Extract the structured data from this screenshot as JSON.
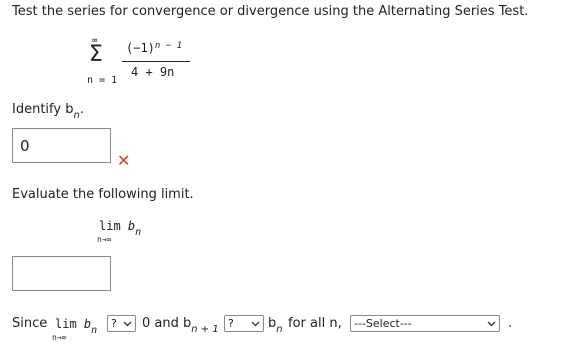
{
  "instructions": "Test the series for convergence or divergence using the Alternating Series Test.",
  "series": {
    "sigma": "Σ",
    "upper": "∞",
    "lower": "n = 1",
    "numerator_base": "(−1)",
    "numerator_exp": "n − 1",
    "denominator": "4 + 9n"
  },
  "identify": {
    "label_prefix": "Identify b",
    "label_sub": "n",
    "label_suffix": ".",
    "answer_value": "0",
    "feedback": "✕"
  },
  "evaluate": {
    "label": "Evaluate the following limit.",
    "lim_word": "lim",
    "b": "b",
    "sub": "n",
    "lim_under": "n→∞",
    "answer_value": ""
  },
  "conclusion": {
    "since": "Since",
    "lim_word": "lim",
    "b": "b",
    "sub": "n",
    "lim_under": "n→∞",
    "select1": "?",
    "middle": "0 and b",
    "sub2": "n + 1",
    "select2": "?",
    "b2": "b",
    "sub3": "n",
    "for_all": "for all n,",
    "select3": "---Select---",
    "period": "."
  },
  "colors": {
    "error": "#e0363a",
    "border": "#8a8a8a"
  }
}
